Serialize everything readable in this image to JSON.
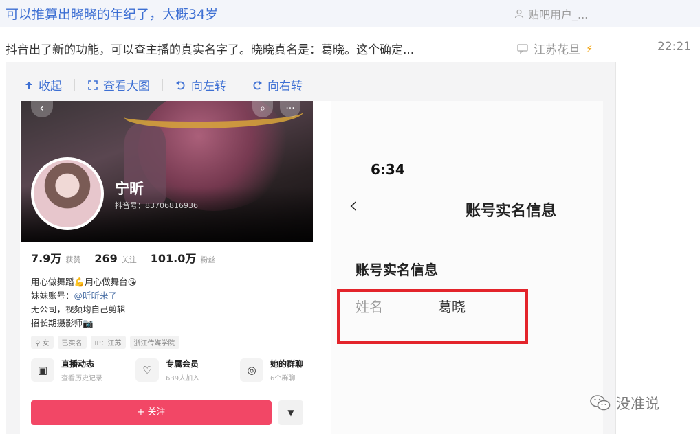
{
  "thread": {
    "title": "可以推算出晓晓的年纪了，大概34岁",
    "title_author": "贴吧用户_...",
    "reply_preview": "抖音出了新的功能，可以查主播的真实名字了。晓晓真名是：葛晓。这个确定...",
    "reply_author": "江苏花旦",
    "reply_time": "22:21"
  },
  "viewer": {
    "toolbar": {
      "collapse": "收起",
      "view_large": "查看大图",
      "rotate_left": "向左转",
      "rotate_right": "向右转"
    }
  },
  "left_screenshot": {
    "name": "宁昕",
    "douyin_id": "抖音号：83706816936",
    "stats": [
      {
        "value": "7.9万",
        "label": "获赞"
      },
      {
        "value": "269",
        "label": "关注"
      },
      {
        "value": "101.0万",
        "label": "粉丝"
      }
    ],
    "bio_lines": [
      "用心做舞蹈💪用心做舞台😘",
      "妹妹账号：",
      "无公司，视频均自己剪辑",
      "招长期摄影师📷"
    ],
    "sister_link": "@昕昕来了",
    "tags": [
      "♀ 女",
      "已实名",
      "IP：江苏",
      "浙江传媒学院"
    ],
    "features": [
      {
        "title": "直播动态",
        "sub": "查看历史记录"
      },
      {
        "title": "专属会员",
        "sub": "639人加入"
      },
      {
        "title": "她的群聊",
        "sub": "6个群聊"
      }
    ],
    "follow_label": "+ 关注",
    "more_label": "▼"
  },
  "right_screenshot": {
    "time": "6:34",
    "nav_title": "账号实名信息",
    "section_title": "账号实名信息",
    "name_label": "姓名",
    "name_value": "葛晓",
    "highlight_color": "#e3242b"
  },
  "watermark": {
    "text": "没准说"
  },
  "colors": {
    "link_blue": "#3d6fd3",
    "follow_red": "#f24766",
    "bolt_orange": "#f2a20c"
  }
}
